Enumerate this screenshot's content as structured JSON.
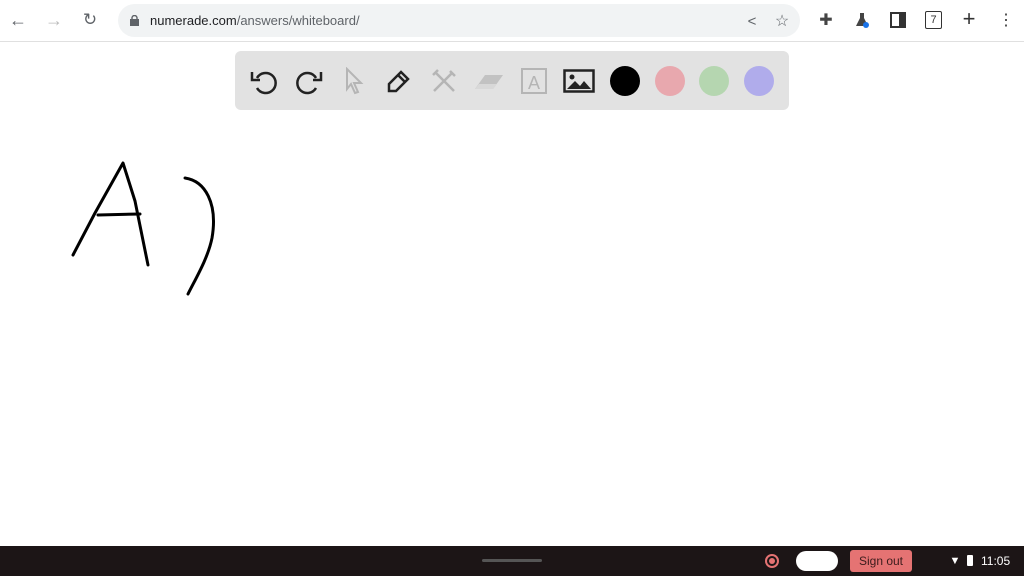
{
  "browser": {
    "url_host": "numerade.com",
    "url_path": "/answers/whiteboard/",
    "tab_count": "7"
  },
  "toolbar": {
    "tools": [
      "undo-icon",
      "redo-icon",
      "select-icon",
      "pen-icon",
      "tools-icon",
      "eraser-icon",
      "text-icon",
      "image-icon"
    ],
    "colors": [
      "#000000",
      "#e8a8ae",
      "#b5d6b0",
      "#b0aceb"
    ]
  },
  "canvas": {
    "drawn_text": "A)"
  },
  "shelf": {
    "sign_out": "Sign out",
    "time": "11:05",
    "accent": "#e57373"
  }
}
